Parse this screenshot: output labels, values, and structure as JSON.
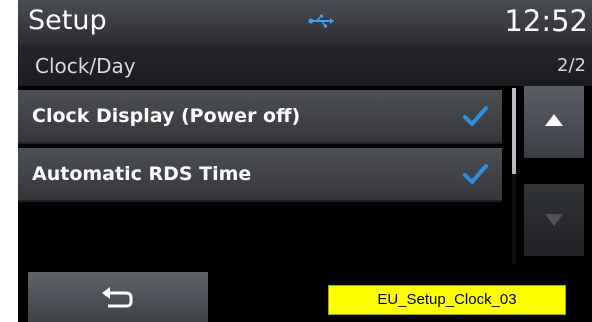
{
  "header": {
    "title": "Setup",
    "time": "12:52",
    "status_icon": "usb-icon"
  },
  "subheader": {
    "title": "Clock/Day",
    "page": "2/2"
  },
  "options": [
    {
      "label": "Clock Display (Power off)",
      "checked": true
    },
    {
      "label": "Automatic RDS Time",
      "checked": true
    }
  ],
  "nav": {
    "up_icon": "arrow-up-icon",
    "down_icon": "arrow-down-icon",
    "back_icon": "back-arrow-icon"
  },
  "annotation": {
    "label": "EU_Setup_Clock_03"
  },
  "colors": {
    "accent": "#2e8fe0",
    "annotation_bg": "#ffff00"
  }
}
